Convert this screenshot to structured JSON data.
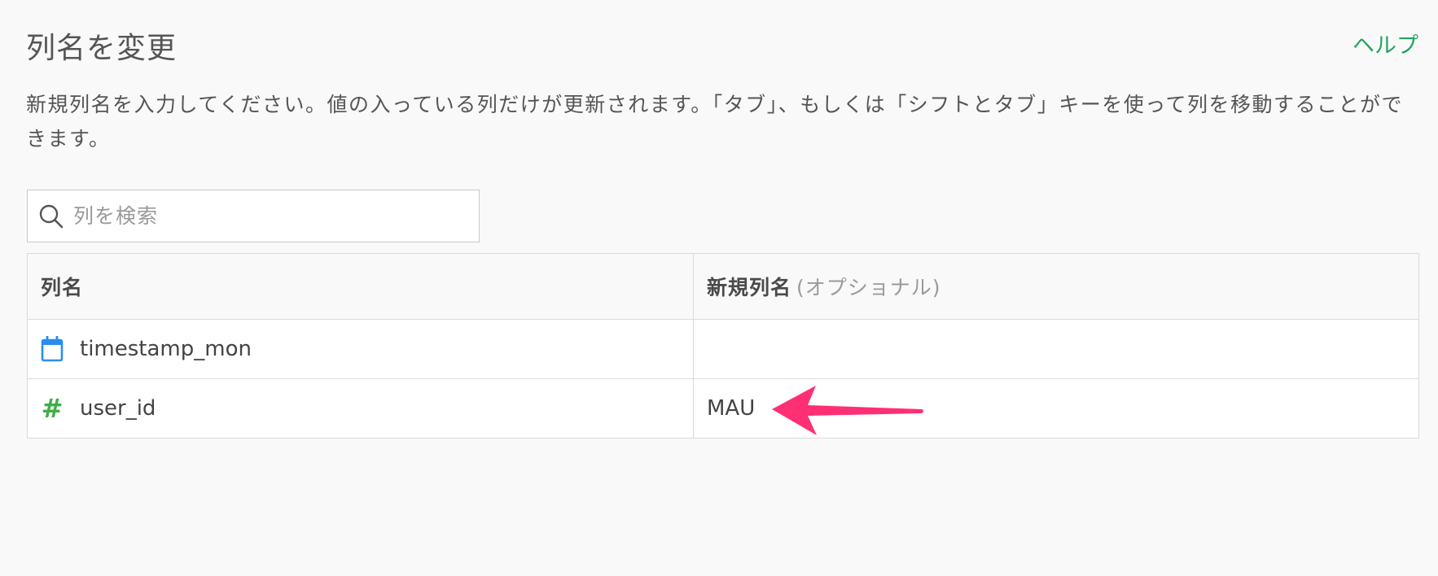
{
  "header": {
    "title": "列名を変更",
    "help_label": "ヘルプ"
  },
  "description": "新規列名を入力してください。値の入っている列だけが更新されます。「タブ」、もしくは「シフトとタブ」キーを使って列を移動することができます。",
  "search": {
    "placeholder": "列を検索",
    "value": ""
  },
  "table": {
    "headers": {
      "column_name": "列名",
      "new_column_name": "新規列名",
      "optional_note": "(オプショナル)"
    },
    "rows": [
      {
        "type_icon": "calendar-icon",
        "name": "timestamp_mon",
        "new_name": ""
      },
      {
        "type_icon": "hash-icon",
        "name": "user_id",
        "new_name": "MAU"
      }
    ]
  },
  "colors": {
    "accent_green": "#25a562",
    "calendar_blue": "#2a8ef0",
    "number_green": "#3fae4a",
    "arrow_pink": "#ff2f74"
  }
}
